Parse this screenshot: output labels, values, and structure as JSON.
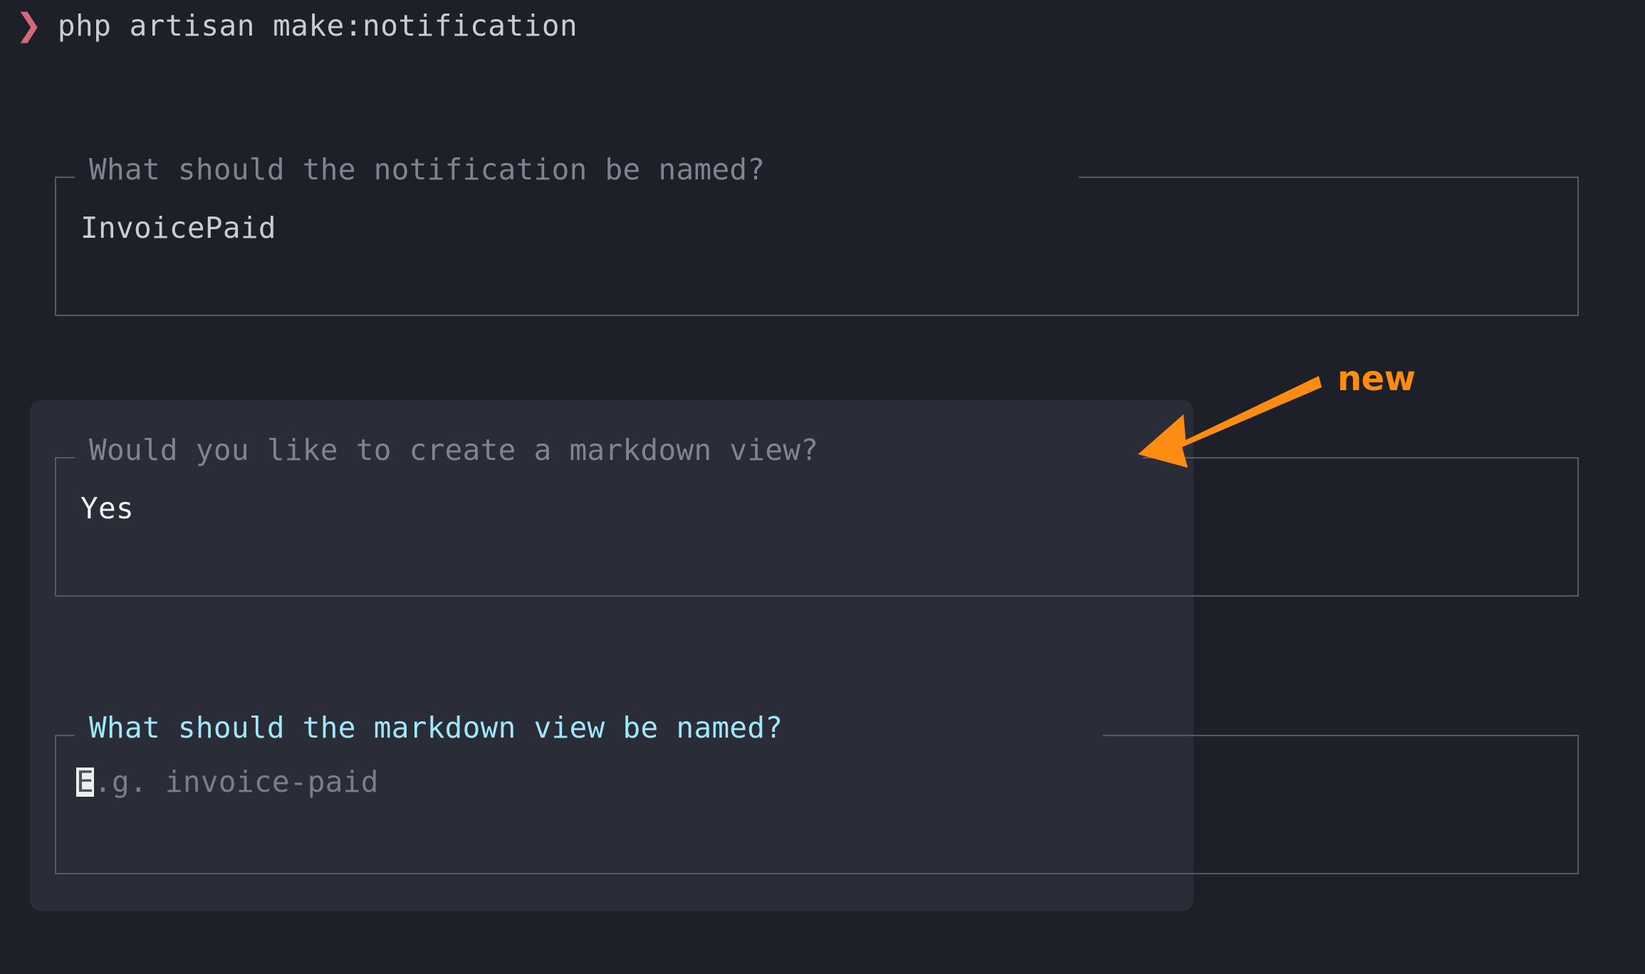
{
  "terminal": {
    "background_color": "#1e2029",
    "prompt_symbol": "❯",
    "prompt_color": "#d4697a",
    "command": "php artisan make:notification"
  },
  "prompts": [
    {
      "id": "notification-name",
      "label": "What should the notification be named?",
      "value": "InvoicePaid",
      "state": "answered",
      "label_color": "#7f8590",
      "value_color": "#c9cdd3"
    },
    {
      "id": "markdown-confirm",
      "label": "Would you like to create a markdown view?",
      "value": "Yes",
      "state": "answered",
      "label_color": "#7f8590",
      "value_color": "#f0f2f4"
    },
    {
      "id": "markdown-name",
      "label": "What should the markdown view be named?",
      "placeholder": "E.g. invoice-paid",
      "cursor_char": "E",
      "placeholder_rest": ".g. invoice-paid",
      "value": "",
      "state": "active",
      "label_color": "#9fe7fb",
      "value_color": "#787e8a",
      "cursor_color": "#eceee9"
    }
  ],
  "highlight": {
    "background_color": "#2a2c38"
  },
  "annotation": {
    "label": "new",
    "color": "#ff8c12",
    "arrow_icon": "arrow-left-icon"
  }
}
